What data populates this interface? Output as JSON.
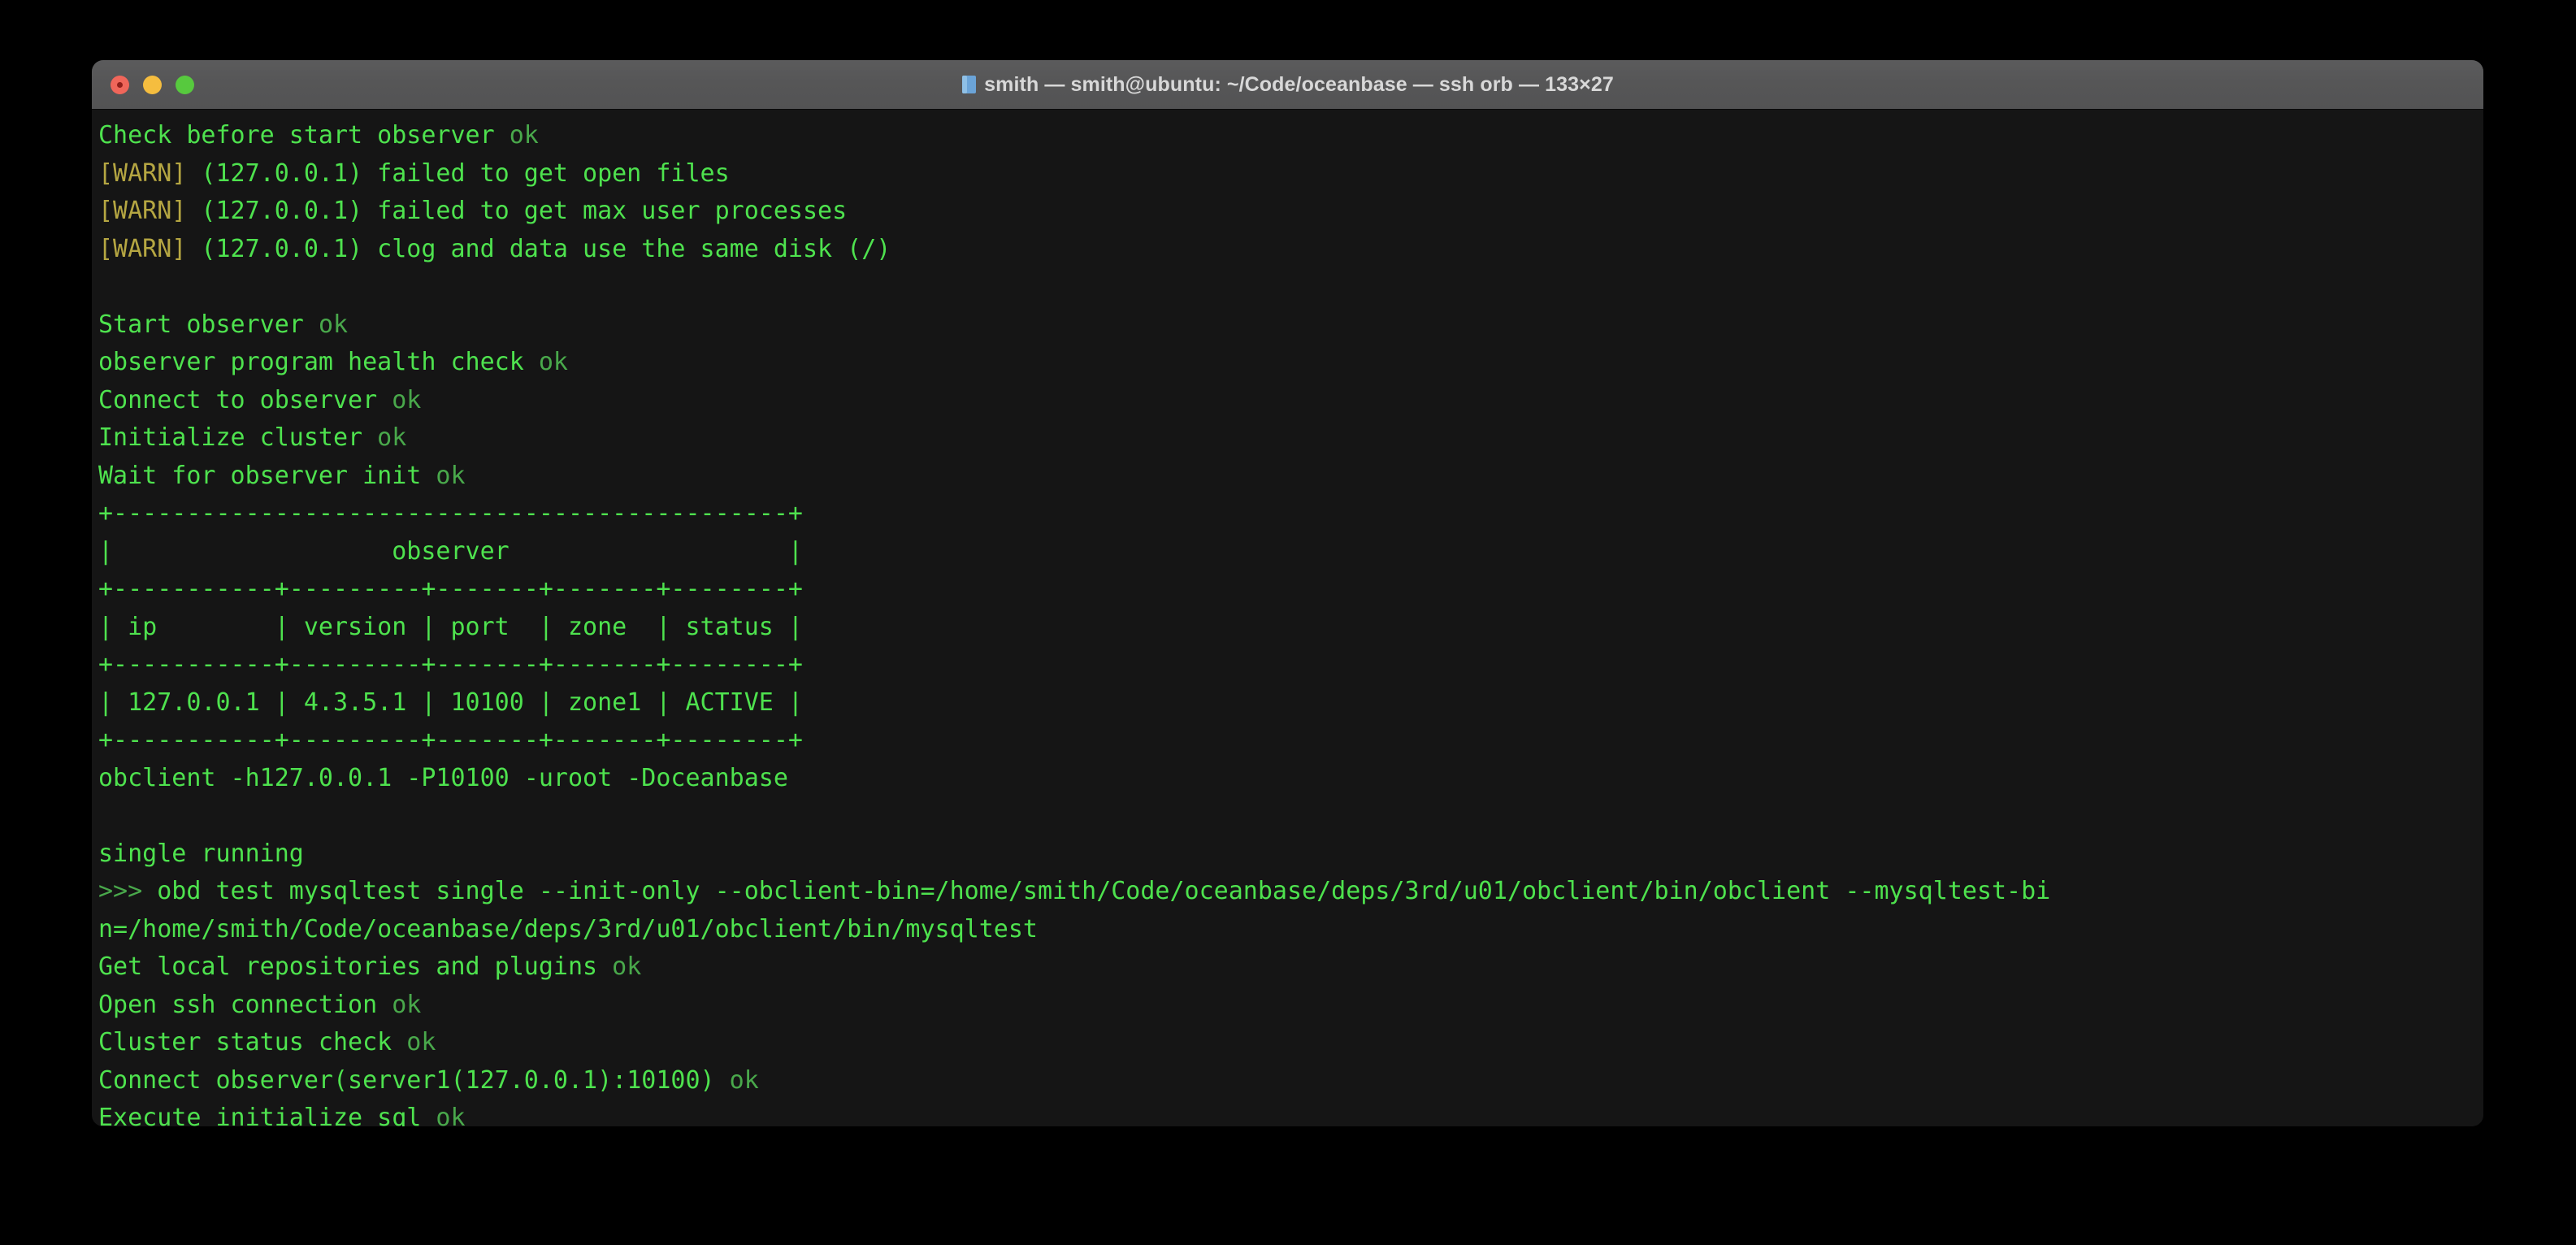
{
  "window": {
    "title": "smith — smith@ubuntu: ~/Code/oceanbase — ssh orb — 133×27",
    "folder_icon": "folder-icon",
    "traffic_lights": {
      "close_label": "close",
      "minimize_label": "minimize",
      "maximize_label": "maximize",
      "close_color": "#f0665a",
      "minimize_color": "#f5bd3f",
      "maximize_color": "#57c93e"
    },
    "titlebar_color": "#565657",
    "background_color": "#151515",
    "size_label": "133×27"
  },
  "theme": {
    "text_green": "#4ee24e",
    "ok_green": "#49a84b",
    "warn_yellow": "#b5a642",
    "desktop": "#000000"
  },
  "terminal": {
    "lines": [
      {
        "id": "line-check-before-start",
        "segments": [
          {
            "text": "Check before start observer ",
            "color": "green"
          },
          {
            "text": "ok",
            "color": "ok"
          }
        ]
      },
      {
        "id": "line-warn-open-files",
        "segments": [
          {
            "text": "[WARN]",
            "color": "warn"
          },
          {
            "text": " (127.0.0.1) failed to get open files",
            "color": "green"
          }
        ]
      },
      {
        "id": "line-warn-max-user-processes",
        "segments": [
          {
            "text": "[WARN]",
            "color": "warn"
          },
          {
            "text": " (127.0.0.1) failed to get max user processes",
            "color": "green"
          }
        ]
      },
      {
        "id": "line-warn-clog-same-disk",
        "segments": [
          {
            "text": "[WARN]",
            "color": "warn"
          },
          {
            "text": " (127.0.0.1) clog and data use the same disk (/)",
            "color": "green"
          }
        ]
      },
      {
        "id": "line-blank-1",
        "segments": [
          {
            "text": " ",
            "color": "green"
          }
        ]
      },
      {
        "id": "line-start-observer",
        "segments": [
          {
            "text": "Start observer ",
            "color": "green"
          },
          {
            "text": "ok",
            "color": "ok"
          }
        ]
      },
      {
        "id": "line-observer-health-check",
        "segments": [
          {
            "text": "observer program health check ",
            "color": "green"
          },
          {
            "text": "ok",
            "color": "ok"
          }
        ]
      },
      {
        "id": "line-connect-to-observer",
        "segments": [
          {
            "text": "Connect to observer ",
            "color": "green"
          },
          {
            "text": "ok",
            "color": "ok"
          }
        ]
      },
      {
        "id": "line-initialize-cluster",
        "segments": [
          {
            "text": "Initialize cluster ",
            "color": "green"
          },
          {
            "text": "ok",
            "color": "ok"
          }
        ]
      },
      {
        "id": "line-wait-for-observer-init",
        "segments": [
          {
            "text": "Wait for observer init ",
            "color": "green"
          },
          {
            "text": "ok",
            "color": "ok"
          }
        ]
      },
      {
        "id": "line-table-top-border",
        "segments": [
          {
            "text": "+----------------------------------------------+",
            "color": "green"
          }
        ]
      },
      {
        "id": "line-table-caption",
        "segments": [
          {
            "text": "|                   observer                   |",
            "color": "green"
          }
        ]
      },
      {
        "id": "line-table-header-sep",
        "segments": [
          {
            "text": "+-----------+---------+-------+-------+--------+",
            "color": "green"
          }
        ]
      },
      {
        "id": "line-table-header",
        "segments": [
          {
            "text": "| ip        | version | port  | zone  | status |",
            "color": "green"
          }
        ]
      },
      {
        "id": "line-table-mid-sep",
        "segments": [
          {
            "text": "+-----------+---------+-------+-------+--------+",
            "color": "green"
          }
        ]
      },
      {
        "id": "line-table-row-1",
        "segments": [
          {
            "text": "| 127.0.0.1 | 4.3.5.1 | 10100 | zone1 | ACTIVE |",
            "color": "green"
          }
        ]
      },
      {
        "id": "line-table-bottom-border",
        "segments": [
          {
            "text": "+-----------+---------+-------+-------+--------+",
            "color": "green"
          }
        ]
      },
      {
        "id": "line-obclient-cmd",
        "segments": [
          {
            "text": "obclient -h127.0.0.1 -P10100 -uroot -Doceanbase",
            "color": "green"
          }
        ]
      },
      {
        "id": "line-blank-2",
        "segments": [
          {
            "text": " ",
            "color": "green"
          }
        ]
      },
      {
        "id": "line-single-running",
        "segments": [
          {
            "text": "single running",
            "color": "green"
          }
        ]
      },
      {
        "id": "line-obd-test-command",
        "segments": [
          {
            "text": ">>> ",
            "color": "ok"
          },
          {
            "text": "obd test mysqltest single --init-only --obclient-bin=/home/smith/Code/oceanbase/deps/3rd/u01/obclient/bin/obclient --mysqltest-bi",
            "color": "green"
          }
        ]
      },
      {
        "id": "line-obd-test-command-wrap",
        "segments": [
          {
            "text": "n=/home/smith/Code/oceanbase/deps/3rd/u01/obclient/bin/mysqltest",
            "color": "green"
          }
        ]
      },
      {
        "id": "line-get-local-repositories",
        "segments": [
          {
            "text": "Get local repositories and plugins ",
            "color": "green"
          },
          {
            "text": "ok",
            "color": "ok"
          }
        ]
      },
      {
        "id": "line-open-ssh-connection",
        "segments": [
          {
            "text": "Open ssh connection ",
            "color": "green"
          },
          {
            "text": "ok",
            "color": "ok"
          }
        ]
      },
      {
        "id": "line-cluster-status-check",
        "segments": [
          {
            "text": "Cluster status check ",
            "color": "green"
          },
          {
            "text": "ok",
            "color": "ok"
          }
        ]
      },
      {
        "id": "line-connect-observer-server1",
        "segments": [
          {
            "text": "Connect observer(server1(127.0.0.1):10100) ",
            "color": "green"
          },
          {
            "text": "ok",
            "color": "ok"
          }
        ]
      },
      {
        "id": "line-execute-initialize-sql",
        "segments": [
          {
            "text": "Execute initialize sql ",
            "color": "green"
          },
          {
            "text": "ok",
            "color": "ok"
          }
        ]
      }
    ]
  }
}
